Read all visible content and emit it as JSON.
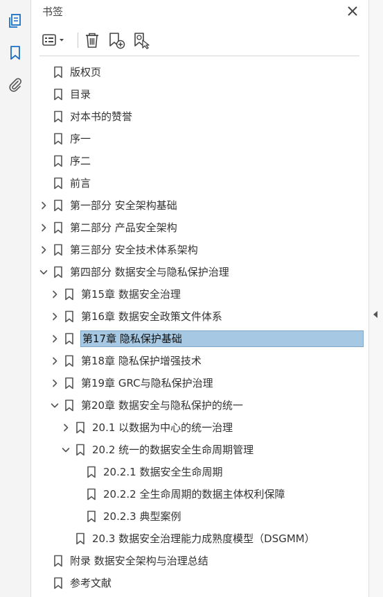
{
  "panel": {
    "title": "书签"
  },
  "tree": [
    {
      "label": "版权页",
      "level": 0,
      "chevron": "none",
      "selected": false
    },
    {
      "label": "目录",
      "level": 0,
      "chevron": "none",
      "selected": false
    },
    {
      "label": "对本书的赞誉",
      "level": 0,
      "chevron": "none",
      "selected": false
    },
    {
      "label": "序一",
      "level": 0,
      "chevron": "none",
      "selected": false
    },
    {
      "label": "序二",
      "level": 0,
      "chevron": "none",
      "selected": false
    },
    {
      "label": "前言",
      "level": 0,
      "chevron": "none",
      "selected": false
    },
    {
      "label": "第一部分 安全架构基础",
      "level": 0,
      "chevron": "right",
      "selected": false
    },
    {
      "label": "第二部分 产品安全架构",
      "level": 0,
      "chevron": "right",
      "selected": false
    },
    {
      "label": "第三部分 安全技术体系架构",
      "level": 0,
      "chevron": "right",
      "selected": false
    },
    {
      "label": "第四部分 数据安全与隐私保护治理",
      "level": 0,
      "chevron": "down",
      "selected": false
    },
    {
      "label": "第15章 数据安全治理",
      "level": 1,
      "chevron": "right",
      "selected": false
    },
    {
      "label": "第16章 数据安全政策文件体系",
      "level": 1,
      "chevron": "right",
      "selected": false
    },
    {
      "label": "第17章 隐私保护基础",
      "level": 1,
      "chevron": "right",
      "selected": true
    },
    {
      "label": "第18章 隐私保护增强技术",
      "level": 1,
      "chevron": "right",
      "selected": false
    },
    {
      "label": "第19章 GRC与隐私保护治理",
      "level": 1,
      "chevron": "right",
      "selected": false
    },
    {
      "label": "第20章 数据安全与隐私保护的统一",
      "level": 1,
      "chevron": "down",
      "selected": false
    },
    {
      "label": "20.1 以数据为中心的统一治理",
      "level": 2,
      "chevron": "right",
      "selected": false
    },
    {
      "label": "20.2 统一的数据安全生命周期管理",
      "level": 2,
      "chevron": "down",
      "selected": false
    },
    {
      "label": "20.2.1 数据安全生命周期",
      "level": 3,
      "chevron": "none",
      "selected": false
    },
    {
      "label": "20.2.2 全生命周期的数据主体权利保障",
      "level": 3,
      "chevron": "none",
      "selected": false
    },
    {
      "label": "20.2.3 典型案例",
      "level": 3,
      "chevron": "none",
      "selected": false
    },
    {
      "label": "20.3 数据安全治理能力成熟度模型（DSGMM）",
      "level": 2,
      "chevron": "none",
      "selected": false
    },
    {
      "label": "附录 数据安全架构与治理总结",
      "level": 0,
      "chevron": "none",
      "selected": false
    },
    {
      "label": "参考文献",
      "level": 0,
      "chevron": "none",
      "selected": false
    }
  ]
}
